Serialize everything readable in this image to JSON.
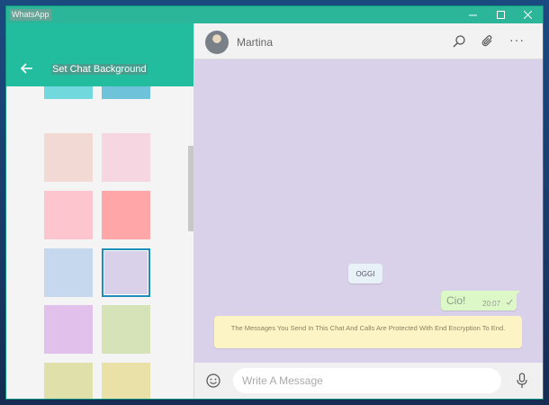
{
  "window": {
    "title": "WhatsApp",
    "controls": [
      "minimize-icon",
      "maximize-icon",
      "close-icon"
    ]
  },
  "left_panel": {
    "title": "Set Chat Background",
    "back_icon": "back-arrow-icon",
    "swatches": [
      {
        "name": "swatch-teal",
        "color": "#71d9dd"
      },
      {
        "name": "swatch-sky",
        "color": "#6ec2d9"
      },
      {
        "name": "swatch-peach",
        "color": "#f3d9d3"
      },
      {
        "name": "swatch-light-pink",
        "color": "#f6d6e0"
      },
      {
        "name": "swatch-pink",
        "color": "#fdc6cf"
      },
      {
        "name": "swatch-salmon",
        "color": "#fea6a8"
      },
      {
        "name": "swatch-light-blue",
        "color": "#c6d8ed"
      },
      {
        "name": "swatch-lavender",
        "color": "#d9d0e9",
        "selected": true
      },
      {
        "name": "swatch-violet",
        "color": "#e2c0ec"
      },
      {
        "name": "swatch-sage",
        "color": "#d6e2b7"
      },
      {
        "name": "swatch-olive",
        "color": "#e0e1aa"
      },
      {
        "name": "swatch-sand",
        "color": "#e9e1a8"
      }
    ]
  },
  "chat": {
    "contact_name": "Martina",
    "header_icons": [
      "search-icon",
      "attach-icon",
      "more-icon"
    ],
    "more_label": "···",
    "background_color": "#d9d0e9",
    "date_chip": "OGGI",
    "messages": [
      {
        "text": "Cio!",
        "time": "20:07",
        "status": "sent"
      }
    ],
    "encryption_notice": "The Messages You Send In This Chat And Calls Are Protected With End Encryption To End.",
    "composer": {
      "placeholder": "Write A Message",
      "emoji_icon": "emoji-icon",
      "mic_icon": "mic-icon"
    }
  },
  "colors": {
    "titlebar": "#2bb69a",
    "panel_header": "#21bd9e",
    "bubble_out": "#dcf8c6",
    "notice": "#fdf4c5",
    "selected_border": "#1d8fb8"
  }
}
